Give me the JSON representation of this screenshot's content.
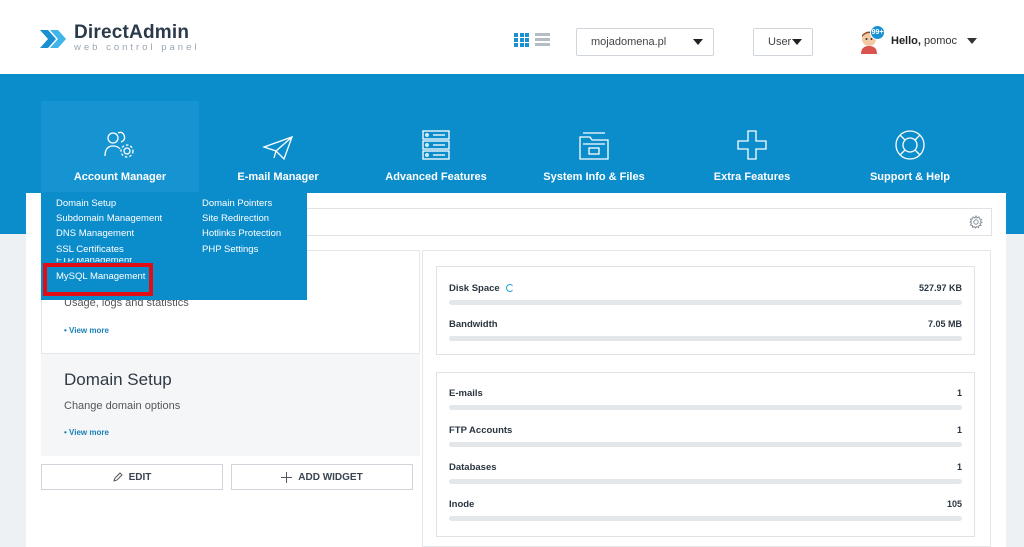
{
  "logo": {
    "title": "DirectAdmin",
    "subtitle": "web control panel"
  },
  "header": {
    "domain_select": "mojadomena.pl",
    "role_select": "User",
    "badge": "99+",
    "hello_prefix": "Hello,",
    "username": "pomoc"
  },
  "nav": [
    {
      "label": "Account Manager",
      "icon": "account-manager-icon"
    },
    {
      "label": "E-mail Manager",
      "icon": "paper-plane-icon"
    },
    {
      "label": "Advanced Features",
      "icon": "server-icon"
    },
    {
      "label": "System Info & Files",
      "icon": "folder-icon"
    },
    {
      "label": "Extra Features",
      "icon": "plus-icon"
    },
    {
      "label": "Support & Help",
      "icon": "lifebuoy-icon"
    }
  ],
  "dropdown": {
    "col1": [
      "Domain Setup",
      "Subdomain Management",
      "DNS Management",
      "SSL Certificates"
    ],
    "hidden": "FTP Management",
    "col2": [
      "Domain Pointers",
      "Site Redirection",
      "Hotlinks Protection",
      "PHP Settings"
    ],
    "highlighted": "MySQL Management"
  },
  "cards": {
    "card1_subtitle": "Usage, logs and statistics",
    "card1_view_more": "• View more",
    "card2_title": "Domain Setup",
    "card2_subtitle": "Change domain options",
    "card2_view_more": "• View more"
  },
  "buttons": {
    "edit": "EDIT",
    "add_widget": "ADD WIDGET"
  },
  "usage": [
    {
      "label": "Disk Space",
      "value": "527.97 KB"
    },
    {
      "label": "Bandwidth",
      "value": "7.05 MB"
    }
  ],
  "counts": [
    {
      "label": "E-mails",
      "value": "1"
    },
    {
      "label": "FTP Accounts",
      "value": "1"
    },
    {
      "label": "Databases",
      "value": "1"
    },
    {
      "label": "Inode",
      "value": "105"
    }
  ],
  "colors": {
    "brand_blue": "#0c8dcb",
    "highlight_red": "#e20d14"
  }
}
